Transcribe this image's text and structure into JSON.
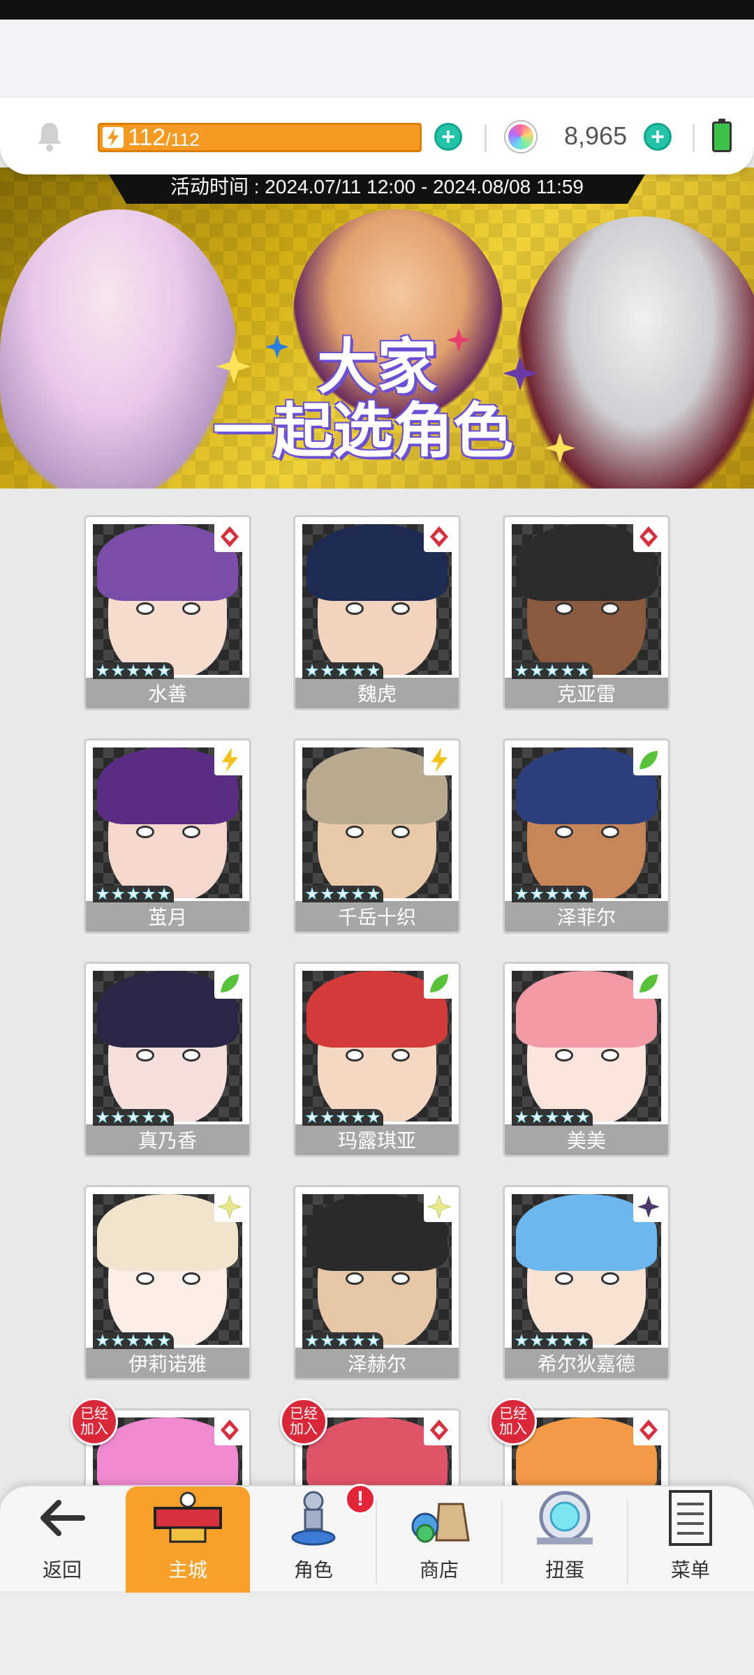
{
  "hud": {
    "stamina_value": "112",
    "stamina_max": "/112",
    "gems": "8,965",
    "colors": {
      "stamina": "#f59a23",
      "plus": "#22c3a6"
    }
  },
  "banner": {
    "event_time": "活动时间 : 2024.07/11 12:00 - 2024.08/08 11:59",
    "title_line1": "大家",
    "title_line2": "一起选角色"
  },
  "characters": [
    {
      "name": "水善",
      "element": "diamond-icon",
      "color": "#d6303e",
      "hair": "#7a4ea8",
      "skin": "#f6dccf",
      "joined": false
    },
    {
      "name": "魏虎",
      "element": "diamond-icon",
      "color": "#d6303e",
      "hair": "#1f2a52",
      "skin": "#f2d3bd",
      "joined": false
    },
    {
      "name": "克亚雷",
      "element": "diamond-icon",
      "color": "#d6303e",
      "hair": "#2b2b2b",
      "skin": "#8a5a3e",
      "joined": false
    },
    {
      "name": "茧月",
      "element": "lightning-icon",
      "color": "#f5c21a",
      "hair": "#5a2c84",
      "skin": "#f4d8cd",
      "joined": false
    },
    {
      "name": "千岳十织",
      "element": "lightning-icon",
      "color": "#f5c21a",
      "hair": "#b8ab92",
      "skin": "#e8c9aa",
      "joined": false
    },
    {
      "name": "泽菲尔",
      "element": "leaf-icon",
      "color": "#58c23a",
      "hair": "#2c3f7a",
      "skin": "#c6865a",
      "joined": false
    },
    {
      "name": "真乃香",
      "element": "leaf-icon",
      "color": "#58c23a",
      "hair": "#2c2646",
      "skin": "#f5e0dd",
      "joined": false
    },
    {
      "name": "玛露琪亚",
      "element": "leaf-icon",
      "color": "#58c23a",
      "hair": "#d33a3a",
      "skin": "#f5d8c4",
      "joined": false
    },
    {
      "name": "美美",
      "element": "leaf-icon",
      "color": "#58c23a",
      "hair": "#f29aa6",
      "skin": "#f9e5dc",
      "joined": false
    },
    {
      "name": "伊莉诺雅",
      "element": "light-sparkle-icon",
      "color": "#e8e98a",
      "hair": "#f1e4cf",
      "skin": "#fbeee6",
      "joined": false
    },
    {
      "name": "泽赫尔",
      "element": "light-sparkle-icon",
      "color": "#e8e98a",
      "hair": "#2a2a2a",
      "skin": "#e6c7a7",
      "joined": false
    },
    {
      "name": "希尔狄嘉德",
      "element": "dark-sparkle-icon",
      "color": "#4a3a6a",
      "hair": "#6db6ee",
      "skin": "#f7e2d4",
      "joined": false
    },
    {
      "name": "",
      "element": "diamond-icon",
      "color": "#d6303e",
      "hair": "#f08ad0",
      "skin": "#f6dccf",
      "joined": true
    },
    {
      "name": "",
      "element": "diamond-icon",
      "color": "#d6303e",
      "hair": "#e0546a",
      "skin": "#f6dccf",
      "joined": true
    },
    {
      "name": "",
      "element": "diamond-icon",
      "color": "#d6303e",
      "hair": "#f39a48",
      "skin": "#f6dccf",
      "joined": true
    }
  ],
  "joined_label": "已经加入",
  "nav": {
    "back": "返回",
    "home": "主城",
    "characters": "角色",
    "shop": "商店",
    "gacha": "扭蛋",
    "menu": "菜单",
    "characters_badge": "!"
  }
}
